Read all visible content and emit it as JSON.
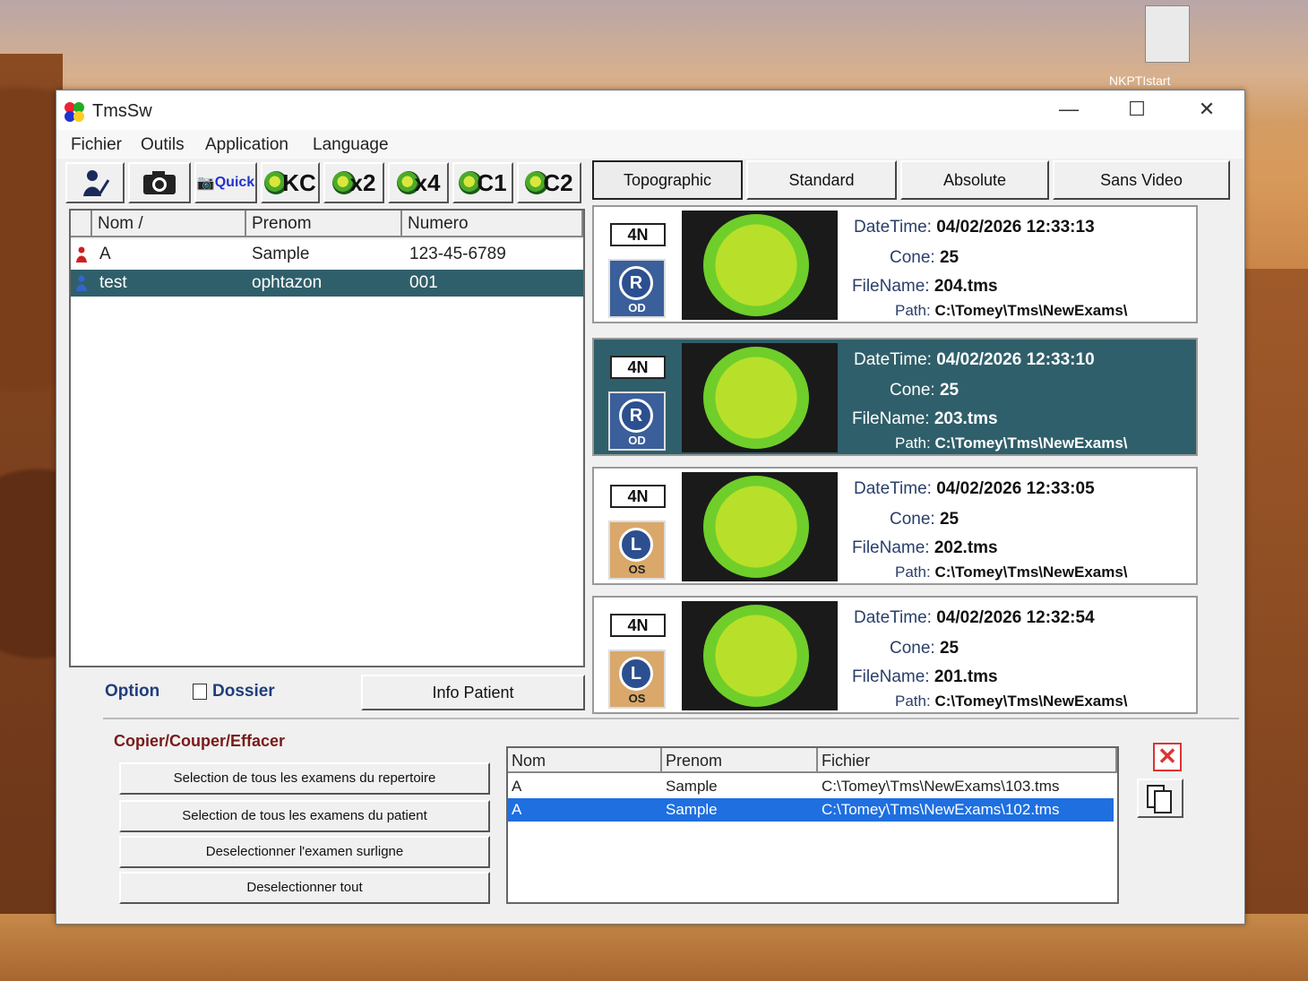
{
  "desktop": {
    "icon_label": "NKPTIstart"
  },
  "window": {
    "title": "TmsSw",
    "controls": {
      "minimize": "—",
      "maximize": "☐",
      "close": "✕"
    }
  },
  "menu": [
    "Fichier",
    "Outils",
    "Application",
    "Language"
  ],
  "toolbar": {
    "buttons": [
      {
        "label": "",
        "icon": "person-edit-icon"
      },
      {
        "label": "",
        "icon": "camera-icon"
      },
      {
        "label": "Quick",
        "icon": "camera-quick-icon"
      },
      {
        "label": "KC",
        "icon": "eye-map-icon"
      },
      {
        "label": "x2",
        "icon": "eye-map-icon"
      },
      {
        "label": "x4",
        "icon": "eye-map-icon"
      },
      {
        "label": "C1",
        "icon": "eye-map-icon"
      },
      {
        "label": "C2",
        "icon": "eye-map-icon"
      }
    ]
  },
  "tabs": [
    "Topographic",
    "Standard",
    "Absolute",
    "Sans Video"
  ],
  "patients": {
    "columns": [
      "Nom /",
      "Prenom",
      "Numero"
    ],
    "rows": [
      {
        "nom": "A",
        "prenom": "Sample",
        "numero": "123-45-6789"
      },
      {
        "nom": "test",
        "prenom": "ophtazon",
        "numero": "001"
      }
    ]
  },
  "option": {
    "label": "Option",
    "dossier": "Dossier",
    "info_patient": "Info Patient"
  },
  "exams": [
    {
      "code": "4N",
      "eye": "R",
      "side": "OD",
      "datetime_label": "DateTime:",
      "datetime": "04/02/2026 12:33:13",
      "cone_label": "Cone:",
      "cone": "25",
      "file_label": "FileName:",
      "file": "204.tms",
      "path_label": "Path:",
      "path": "C:\\Tomey\\Tms\\NewExams\\"
    },
    {
      "code": "4N",
      "eye": "R",
      "side": "OD",
      "datetime_label": "DateTime:",
      "datetime": "04/02/2026 12:33:10",
      "cone_label": "Cone:",
      "cone": "25",
      "file_label": "FileName:",
      "file": "203.tms",
      "path_label": "Path:",
      "path": "C:\\Tomey\\Tms\\NewExams\\"
    },
    {
      "code": "4N",
      "eye": "L",
      "side": "OS",
      "datetime_label": "DateTime:",
      "datetime": "04/02/2026 12:33:05",
      "cone_label": "Cone:",
      "cone": "25",
      "file_label": "FileName:",
      "file": "202.tms",
      "path_label": "Path:",
      "path": "C:\\Tomey\\Tms\\NewExams\\"
    },
    {
      "code": "4N",
      "eye": "L",
      "side": "OS",
      "datetime_label": "DateTime:",
      "datetime": "04/02/2026 12:32:54",
      "cone_label": "Cone:",
      "cone": "25",
      "file_label": "FileName:",
      "file": "201.tms",
      "path_label": "Path:",
      "path": "C:\\Tomey\\Tms\\NewExams\\"
    }
  ],
  "bottom": {
    "title": "Copier/Couper/Effacer",
    "actions": [
      "Selection de tous les examens du repertoire",
      "Selection de tous les examens du patient",
      "Deselectionner l'examen surligne",
      "Deselectionner tout"
    ],
    "files": {
      "columns": [
        "Nom",
        "Prenom",
        "Fichier"
      ],
      "rows": [
        {
          "nom": "A",
          "prenom": "Sample",
          "fichier": "C:\\Tomey\\Tms\\NewExams\\103.tms"
        },
        {
          "nom": "A",
          "prenom": "Sample",
          "fichier": "C:\\Tomey\\Tms\\NewExams\\102.tms"
        }
      ]
    },
    "close_symbol": "✕"
  },
  "colors": {
    "selection_teal": "#2f5f6a",
    "selection_blue": "#1f6fe0",
    "label_blue": "#1f3e7a",
    "title_red": "#7a1a1a"
  }
}
